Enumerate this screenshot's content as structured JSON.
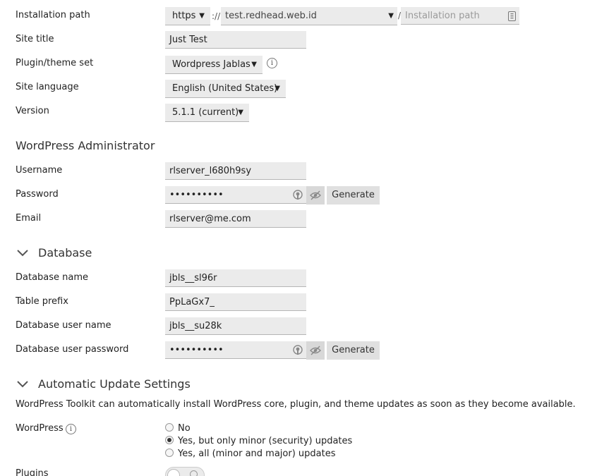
{
  "general": {
    "installation_path_label": "Installation path",
    "protocol": "https",
    "protocol_sep": "://",
    "domain": "test.redhead.web.id",
    "path_sep": "/",
    "path_placeholder": "Installation path",
    "site_title_label": "Site title",
    "site_title": "Just Test",
    "plugin_set_label": "Plugin/theme set",
    "plugin_set": "Wordpress Jablas",
    "language_label": "Site language",
    "language": "English (United States)",
    "version_label": "Version",
    "version": "5.1.1 (current)"
  },
  "admin": {
    "heading": "WordPress Administrator",
    "username_label": "Username",
    "username": "rlserver_l680h9sy",
    "password_label": "Password",
    "password": "••••••••••",
    "generate_label": "Generate",
    "email_label": "Email",
    "email": "rlserver@me.com"
  },
  "database": {
    "heading": "Database",
    "name_label": "Database name",
    "name": "jbls__sl96r",
    "prefix_label": "Table prefix",
    "prefix": "PpLaGx7_",
    "user_label": "Database user name",
    "user": "jbls__su28k",
    "password_label": "Database user password",
    "password": "••••••••••",
    "generate_label": "Generate"
  },
  "updates": {
    "heading": "Automatic Update Settings",
    "description": "WordPress Toolkit can automatically install WordPress core, plugin, and theme updates as soon as they become available.",
    "wordpress_label": "WordPress",
    "options": [
      "No",
      "Yes, but only minor (security) updates",
      "Yes, all (minor and major) updates"
    ],
    "selected_index": 1,
    "plugins_label": "Plugins"
  },
  "icons": {
    "dropdown": "caret-down-icon",
    "info": "info-icon",
    "key": "key-icon",
    "eye_off": "eye-off-icon",
    "chevron": "chevron-down-icon"
  }
}
